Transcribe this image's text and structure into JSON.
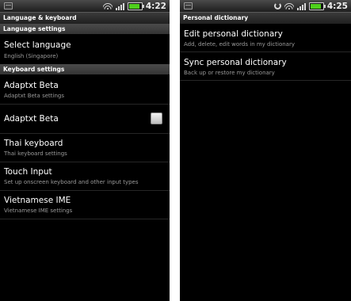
{
  "left_screen": {
    "status": {
      "time": "4:22"
    },
    "title": "Language & keyboard",
    "language_settings": {
      "header": "Language settings",
      "select_language": {
        "title": "Select language",
        "summary": "English (Singapore)"
      }
    },
    "keyboard_settings": {
      "header": "Keyboard settings",
      "items": [
        {
          "title": "Adaptxt Beta",
          "summary": "Adaptxt Beta settings"
        },
        {
          "title": "Adaptxt Beta",
          "checked": false
        },
        {
          "title": "Thai keyboard",
          "summary": "Thai keyboard settings"
        },
        {
          "title": "Touch Input",
          "summary": "Set up onscreen keyboard and other input types"
        },
        {
          "title": "Vietnamese IME",
          "summary": "Vietnamese IME settings"
        }
      ]
    }
  },
  "right_screen": {
    "status": {
      "time": "4:25"
    },
    "title": "Personal dictionary",
    "items": [
      {
        "title": "Edit personal dictionary",
        "summary": "Add, delete, edit words in my dictionary"
      },
      {
        "title": "Sync personal dictionary",
        "summary": "Back up or restore my dictionary"
      }
    ]
  },
  "colors": {
    "background": "#000000",
    "battery": "#4fd01c",
    "summary_text": "#9a9a9a"
  },
  "icons": [
    "notification-icon",
    "wifi-icon",
    "signal-icon",
    "battery-icon",
    "sync-icon",
    "checkbox-icon"
  ]
}
